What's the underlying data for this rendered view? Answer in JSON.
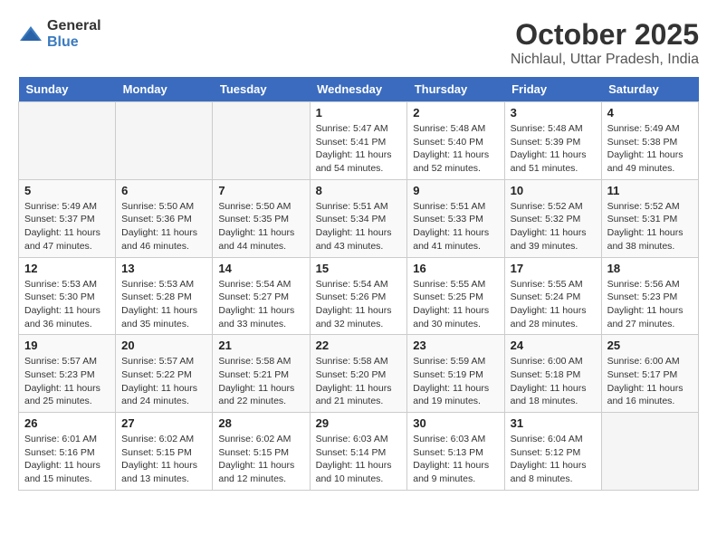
{
  "logo": {
    "text_general": "General",
    "text_blue": "Blue"
  },
  "title": "October 2025",
  "subtitle": "Nichlaul, Uttar Pradesh, India",
  "headers": [
    "Sunday",
    "Monday",
    "Tuesday",
    "Wednesday",
    "Thursday",
    "Friday",
    "Saturday"
  ],
  "weeks": [
    [
      {
        "day": "",
        "info": ""
      },
      {
        "day": "",
        "info": ""
      },
      {
        "day": "",
        "info": ""
      },
      {
        "day": "1",
        "info": "Sunrise: 5:47 AM\nSunset: 5:41 PM\nDaylight: 11 hours and 54 minutes."
      },
      {
        "day": "2",
        "info": "Sunrise: 5:48 AM\nSunset: 5:40 PM\nDaylight: 11 hours and 52 minutes."
      },
      {
        "day": "3",
        "info": "Sunrise: 5:48 AM\nSunset: 5:39 PM\nDaylight: 11 hours and 51 minutes."
      },
      {
        "day": "4",
        "info": "Sunrise: 5:49 AM\nSunset: 5:38 PM\nDaylight: 11 hours and 49 minutes."
      }
    ],
    [
      {
        "day": "5",
        "info": "Sunrise: 5:49 AM\nSunset: 5:37 PM\nDaylight: 11 hours and 47 minutes."
      },
      {
        "day": "6",
        "info": "Sunrise: 5:50 AM\nSunset: 5:36 PM\nDaylight: 11 hours and 46 minutes."
      },
      {
        "day": "7",
        "info": "Sunrise: 5:50 AM\nSunset: 5:35 PM\nDaylight: 11 hours and 44 minutes."
      },
      {
        "day": "8",
        "info": "Sunrise: 5:51 AM\nSunset: 5:34 PM\nDaylight: 11 hours and 43 minutes."
      },
      {
        "day": "9",
        "info": "Sunrise: 5:51 AM\nSunset: 5:33 PM\nDaylight: 11 hours and 41 minutes."
      },
      {
        "day": "10",
        "info": "Sunrise: 5:52 AM\nSunset: 5:32 PM\nDaylight: 11 hours and 39 minutes."
      },
      {
        "day": "11",
        "info": "Sunrise: 5:52 AM\nSunset: 5:31 PM\nDaylight: 11 hours and 38 minutes."
      }
    ],
    [
      {
        "day": "12",
        "info": "Sunrise: 5:53 AM\nSunset: 5:30 PM\nDaylight: 11 hours and 36 minutes."
      },
      {
        "day": "13",
        "info": "Sunrise: 5:53 AM\nSunset: 5:28 PM\nDaylight: 11 hours and 35 minutes."
      },
      {
        "day": "14",
        "info": "Sunrise: 5:54 AM\nSunset: 5:27 PM\nDaylight: 11 hours and 33 minutes."
      },
      {
        "day": "15",
        "info": "Sunrise: 5:54 AM\nSunset: 5:26 PM\nDaylight: 11 hours and 32 minutes."
      },
      {
        "day": "16",
        "info": "Sunrise: 5:55 AM\nSunset: 5:25 PM\nDaylight: 11 hours and 30 minutes."
      },
      {
        "day": "17",
        "info": "Sunrise: 5:55 AM\nSunset: 5:24 PM\nDaylight: 11 hours and 28 minutes."
      },
      {
        "day": "18",
        "info": "Sunrise: 5:56 AM\nSunset: 5:23 PM\nDaylight: 11 hours and 27 minutes."
      }
    ],
    [
      {
        "day": "19",
        "info": "Sunrise: 5:57 AM\nSunset: 5:23 PM\nDaylight: 11 hours and 25 minutes."
      },
      {
        "day": "20",
        "info": "Sunrise: 5:57 AM\nSunset: 5:22 PM\nDaylight: 11 hours and 24 minutes."
      },
      {
        "day": "21",
        "info": "Sunrise: 5:58 AM\nSunset: 5:21 PM\nDaylight: 11 hours and 22 minutes."
      },
      {
        "day": "22",
        "info": "Sunrise: 5:58 AM\nSunset: 5:20 PM\nDaylight: 11 hours and 21 minutes."
      },
      {
        "day": "23",
        "info": "Sunrise: 5:59 AM\nSunset: 5:19 PM\nDaylight: 11 hours and 19 minutes."
      },
      {
        "day": "24",
        "info": "Sunrise: 6:00 AM\nSunset: 5:18 PM\nDaylight: 11 hours and 18 minutes."
      },
      {
        "day": "25",
        "info": "Sunrise: 6:00 AM\nSunset: 5:17 PM\nDaylight: 11 hours and 16 minutes."
      }
    ],
    [
      {
        "day": "26",
        "info": "Sunrise: 6:01 AM\nSunset: 5:16 PM\nDaylight: 11 hours and 15 minutes."
      },
      {
        "day": "27",
        "info": "Sunrise: 6:02 AM\nSunset: 5:15 PM\nDaylight: 11 hours and 13 minutes."
      },
      {
        "day": "28",
        "info": "Sunrise: 6:02 AM\nSunset: 5:15 PM\nDaylight: 11 hours and 12 minutes."
      },
      {
        "day": "29",
        "info": "Sunrise: 6:03 AM\nSunset: 5:14 PM\nDaylight: 11 hours and 10 minutes."
      },
      {
        "day": "30",
        "info": "Sunrise: 6:03 AM\nSunset: 5:13 PM\nDaylight: 11 hours and 9 minutes."
      },
      {
        "day": "31",
        "info": "Sunrise: 6:04 AM\nSunset: 5:12 PM\nDaylight: 11 hours and 8 minutes."
      },
      {
        "day": "",
        "info": ""
      }
    ]
  ]
}
